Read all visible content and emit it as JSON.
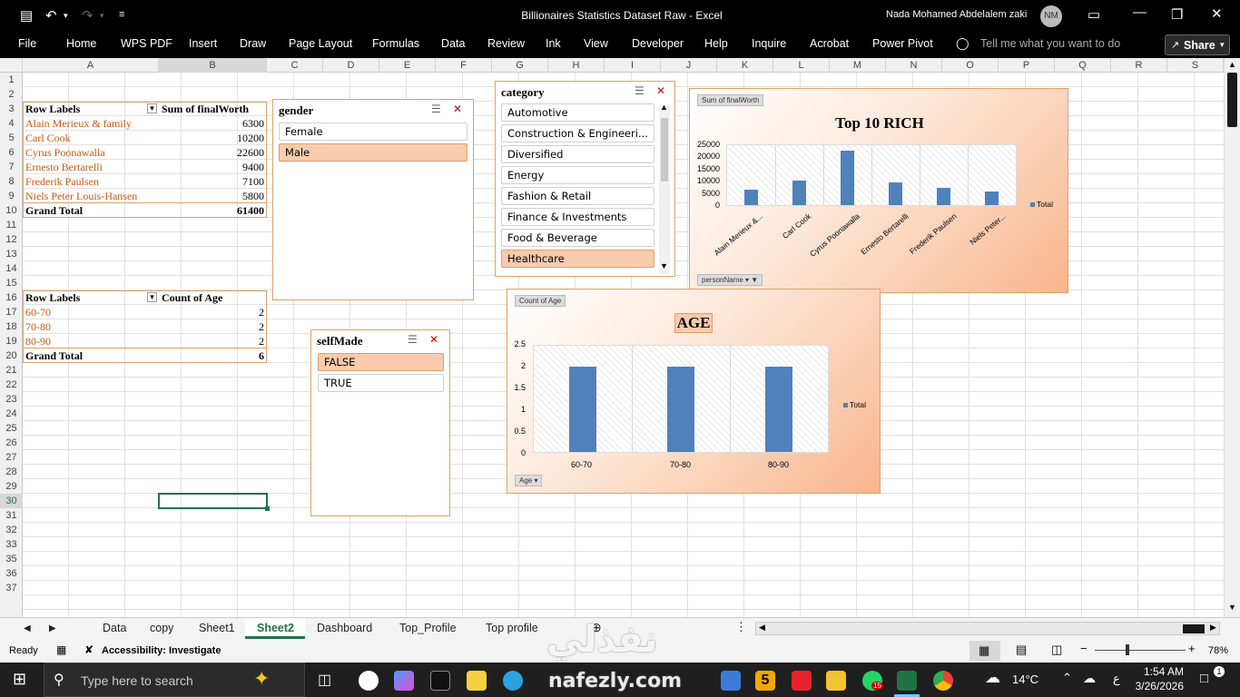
{
  "window": {
    "title": "Billionaires Statistics Dataset Raw  -  Excel",
    "user": "Nada Mohamed Abdelalem zaki",
    "avatar": "NM"
  },
  "ribbon": {
    "tabs": [
      "File",
      "Home",
      "WPS PDF",
      "Insert",
      "Draw",
      "Page Layout",
      "Formulas",
      "Data",
      "Review",
      "Ink",
      "View",
      "Developer",
      "Help",
      "Inquire",
      "Acrobat",
      "Power Pivot"
    ],
    "tell_me": "Tell me what you want to do",
    "share": "Share"
  },
  "columns": [
    "A",
    "B",
    "C",
    "D",
    "E",
    "F",
    "G",
    "H",
    "I",
    "J",
    "K",
    "L",
    "M",
    "N",
    "O",
    "P",
    "Q",
    "R",
    "S"
  ],
  "rows": [
    "1",
    "2",
    "3",
    "4",
    "5",
    "6",
    "7",
    "8",
    "9",
    "10",
    "11",
    "12",
    "13",
    "14",
    "15",
    "16",
    "17",
    "18",
    "19",
    "20",
    "21",
    "22",
    "23",
    "24",
    "25",
    "26",
    "27",
    "28",
    "29",
    "30",
    "31",
    "32",
    "33",
    "35",
    "36",
    "37"
  ],
  "pivot1": {
    "header": [
      "Row Labels",
      "Sum of finalWorth"
    ],
    "rows": [
      [
        "Alain Merieux & family",
        "6300"
      ],
      [
        "Carl Cook",
        "10200"
      ],
      [
        "Cyrus Poonawalla",
        "22600"
      ],
      [
        "Ernesto Bertarelli",
        "9400"
      ],
      [
        "Frederik Paulsen",
        "7100"
      ],
      [
        "Niels Peter Louis-Hansen",
        "5800"
      ]
    ],
    "total": [
      "Grand Total",
      "61400"
    ]
  },
  "pivot2": {
    "header": [
      "Row Labels",
      "Count of Age"
    ],
    "rows": [
      [
        "60-70",
        "2"
      ],
      [
        "70-80",
        "2"
      ],
      [
        "80-90",
        "2"
      ]
    ],
    "total": [
      "Grand Total",
      "6"
    ]
  },
  "slicers": {
    "gender": {
      "title": "gender",
      "items": [
        "Female",
        "Male"
      ],
      "selected": "Male"
    },
    "category": {
      "title": "category",
      "items": [
        "Automotive",
        "Construction & Engineeri...",
        "Diversified",
        "Energy",
        "Fashion & Retail",
        "Finance & Investments",
        "Food & Beverage",
        "Healthcare"
      ],
      "selected": "Healthcare"
    },
    "selfMade": {
      "title": "selfMade",
      "items": [
        "FALSE",
        "TRUE"
      ],
      "selected": "FALSE"
    }
  },
  "chart_data": [
    {
      "type": "bar",
      "title": "Top 10 RICH",
      "field_tag": "Sum of finalWorth",
      "axis_tag": "personName",
      "categories": [
        "Alain Merieux &...",
        "Carl Cook",
        "Cyrus Poonawalla",
        "Ernesto Bertarelli",
        "Frederik Paulsen",
        "Niels Peter..."
      ],
      "series": [
        {
          "name": "Total",
          "values": [
            6300,
            10200,
            22600,
            9400,
            7100,
            5800
          ]
        }
      ],
      "yticks": [
        "25000",
        "20000",
        "15000",
        "10000",
        "5000",
        "0"
      ],
      "ylim": [
        0,
        25000
      ],
      "grid": true,
      "legend": "right"
    },
    {
      "type": "bar",
      "title": "AGE",
      "field_tag": "Count of Age",
      "axis_tag": "Age",
      "categories": [
        "60-70",
        "70-80",
        "80-90"
      ],
      "series": [
        {
          "name": "Total",
          "values": [
            2,
            2,
            2
          ]
        }
      ],
      "yticks": [
        "2.5",
        "2",
        "1.5",
        "1",
        "0.5",
        "0"
      ],
      "ylim": [
        0,
        2.5
      ],
      "grid": true,
      "legend": "right"
    }
  ],
  "sheets": [
    "Data",
    "copy",
    "Sheet1",
    "Sheet2",
    "Dashboard",
    "Top_Profile",
    "Top profile"
  ],
  "active_sheet": "Sheet2",
  "status": {
    "ready": "Ready",
    "accessibility": "Accessibility: Investigate",
    "zoom": "78%"
  },
  "taskbar": {
    "search": "Type here to search",
    "weather": "14°C",
    "time": "1:54 AM",
    "date": "3/26/2026",
    "lang": "ع",
    "notif": "1",
    "badge": "15"
  },
  "watermark": {
    "arabic": "نفذلي",
    "latin": "nafezly.com"
  },
  "colors": {
    "accent": "#c65911",
    "slicer_sel": "#f8cbad",
    "bar": "#4f81bd",
    "excel_green": "#217346"
  }
}
